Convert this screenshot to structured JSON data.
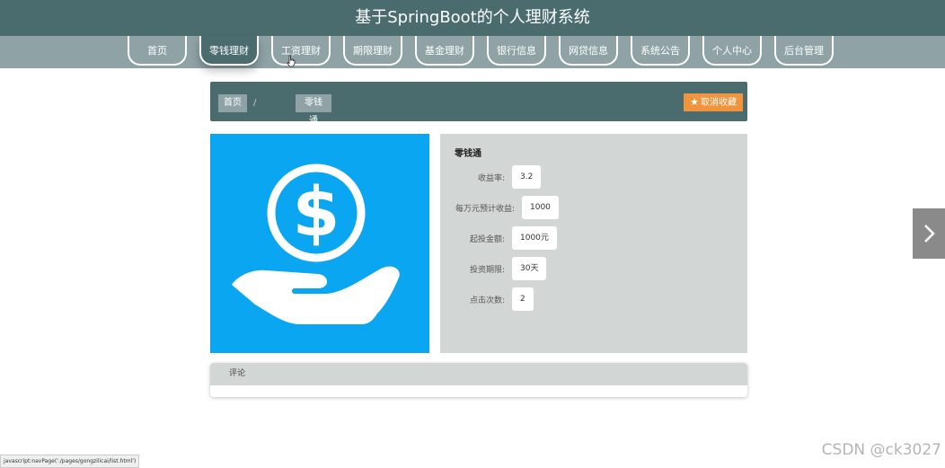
{
  "header": {
    "title": "基于SpringBoot的个人理财系统"
  },
  "nav": {
    "items": [
      {
        "label": "首页"
      },
      {
        "label": "零钱理财"
      },
      {
        "label": "工资理财"
      },
      {
        "label": "期限理财"
      },
      {
        "label": "基金理财"
      },
      {
        "label": "银行信息"
      },
      {
        "label": "网贷信息"
      },
      {
        "label": "系统公告"
      },
      {
        "label": "个人中心"
      },
      {
        "label": "后台管理"
      }
    ],
    "active_label": "零钱理财"
  },
  "breadcrumb": {
    "home": "首页",
    "separator": "/",
    "current": "零钱通"
  },
  "actions": {
    "favorite_label": "取消收藏",
    "favorite_icon": "star-icon"
  },
  "product": {
    "name": "零钱通",
    "image_icon": "money-hand-icon",
    "fields": [
      {
        "label": "收益率:",
        "value": "3.2"
      },
      {
        "label": "每万元预计收益:",
        "value": "1000"
      },
      {
        "label": "起投金额:",
        "value": "1000元"
      },
      {
        "label": "投资期限:",
        "value": "30天"
      },
      {
        "label": "点击次数:",
        "value": "2"
      }
    ]
  },
  "comments": {
    "title": "评论"
  },
  "status_bar": {
    "url": "javascript:navPage('./pages/gongzilicai/list.html')"
  },
  "watermark": "CSDN @ck3027",
  "colors": {
    "header": "#4a6c6f",
    "nav": "#8fa3a6",
    "accent": "#f0953d",
    "image_bg": "#0aa6f2",
    "panel": "#d2d6d5"
  }
}
